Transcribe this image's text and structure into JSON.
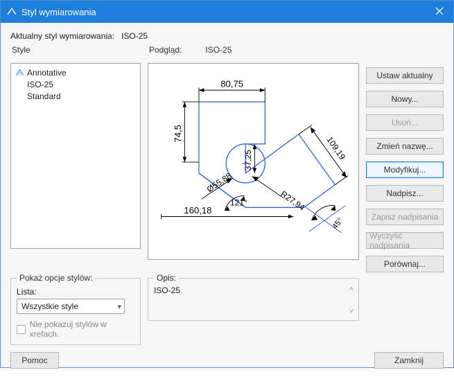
{
  "window": {
    "title": "Styl wymiarowania"
  },
  "current_label": "Aktualny styl wymiarowania:",
  "current_style": "ISO-25",
  "styles_header": "Style",
  "styles": [
    "Annotative",
    "ISO-25",
    "Standard"
  ],
  "preview_header": "Podgląd:",
  "preview_style": "ISO-25",
  "buttons": {
    "set_current": "Ustaw aktualny",
    "new": "Nowy...",
    "delete": "Usuń...",
    "rename": "Zmień nazwę...",
    "modify": "Modyfikuj...",
    "override": "Nadpisz...",
    "save_over": "Zapisz nadpisania",
    "clear_over": "Wyczyść nadpisania",
    "compare": "Porównaj..."
  },
  "filter_group": {
    "legend": "Pokaż opcje stylów:",
    "list_label": "Lista:",
    "list_value": "Wszystkie style",
    "hide_xref": "Nie pokazuj stylów w xrefach."
  },
  "desc": {
    "legend": "Opis:",
    "text": "ISO-25"
  },
  "bottom": {
    "help": "Pomoc",
    "close": "Zamknij"
  },
  "preview_dims": {
    "d1": "80,75",
    "d2": "74,5",
    "d3": "37,25",
    "r": "R27,94",
    "diag": "109,19",
    "dia": "Ø55,88",
    "base": "160,18",
    "ang1": "121°",
    "ang2": "45°"
  }
}
